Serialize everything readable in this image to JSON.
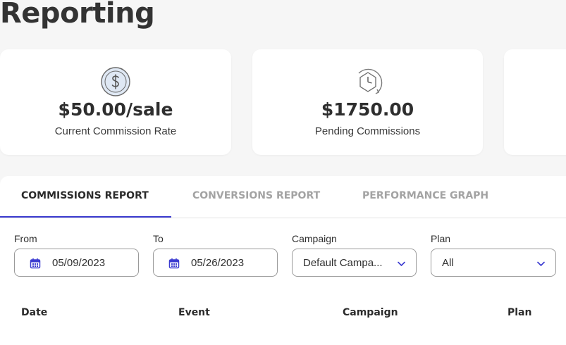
{
  "page": {
    "title": "Reporting"
  },
  "cards": [
    {
      "value": "$50.00/sale",
      "label": "Current Commission Rate",
      "icon": "dollar-icon"
    },
    {
      "value": "$1750.00",
      "label": "Pending Commissions",
      "icon": "clock-icon"
    },
    {
      "value": "",
      "label": ""
    }
  ],
  "tabs": [
    {
      "label": "COMMISSIONS REPORT",
      "active": true
    },
    {
      "label": "CONVERSIONS REPORT",
      "active": false
    },
    {
      "label": "PERFORMANCE GRAPH",
      "active": false
    }
  ],
  "filters": {
    "from": {
      "label": "From",
      "value": "05/09/2023",
      "icon": "calendar-icon"
    },
    "to": {
      "label": "To",
      "value": "05/26/2023",
      "icon": "calendar-icon"
    },
    "campaign": {
      "label": "Campaign",
      "value": "Default Campa...",
      "icon": "chevron-down-icon"
    },
    "plan": {
      "label": "Plan",
      "value": "All",
      "icon": "chevron-down-icon"
    }
  },
  "table": {
    "columns": [
      "Date",
      "Event",
      "Campaign",
      "Plan"
    ]
  },
  "colors": {
    "accent": "#3b3bd0",
    "background": "#f6f6f6",
    "card": "#ffffff",
    "inactive_tab": "#a3a3a3"
  }
}
